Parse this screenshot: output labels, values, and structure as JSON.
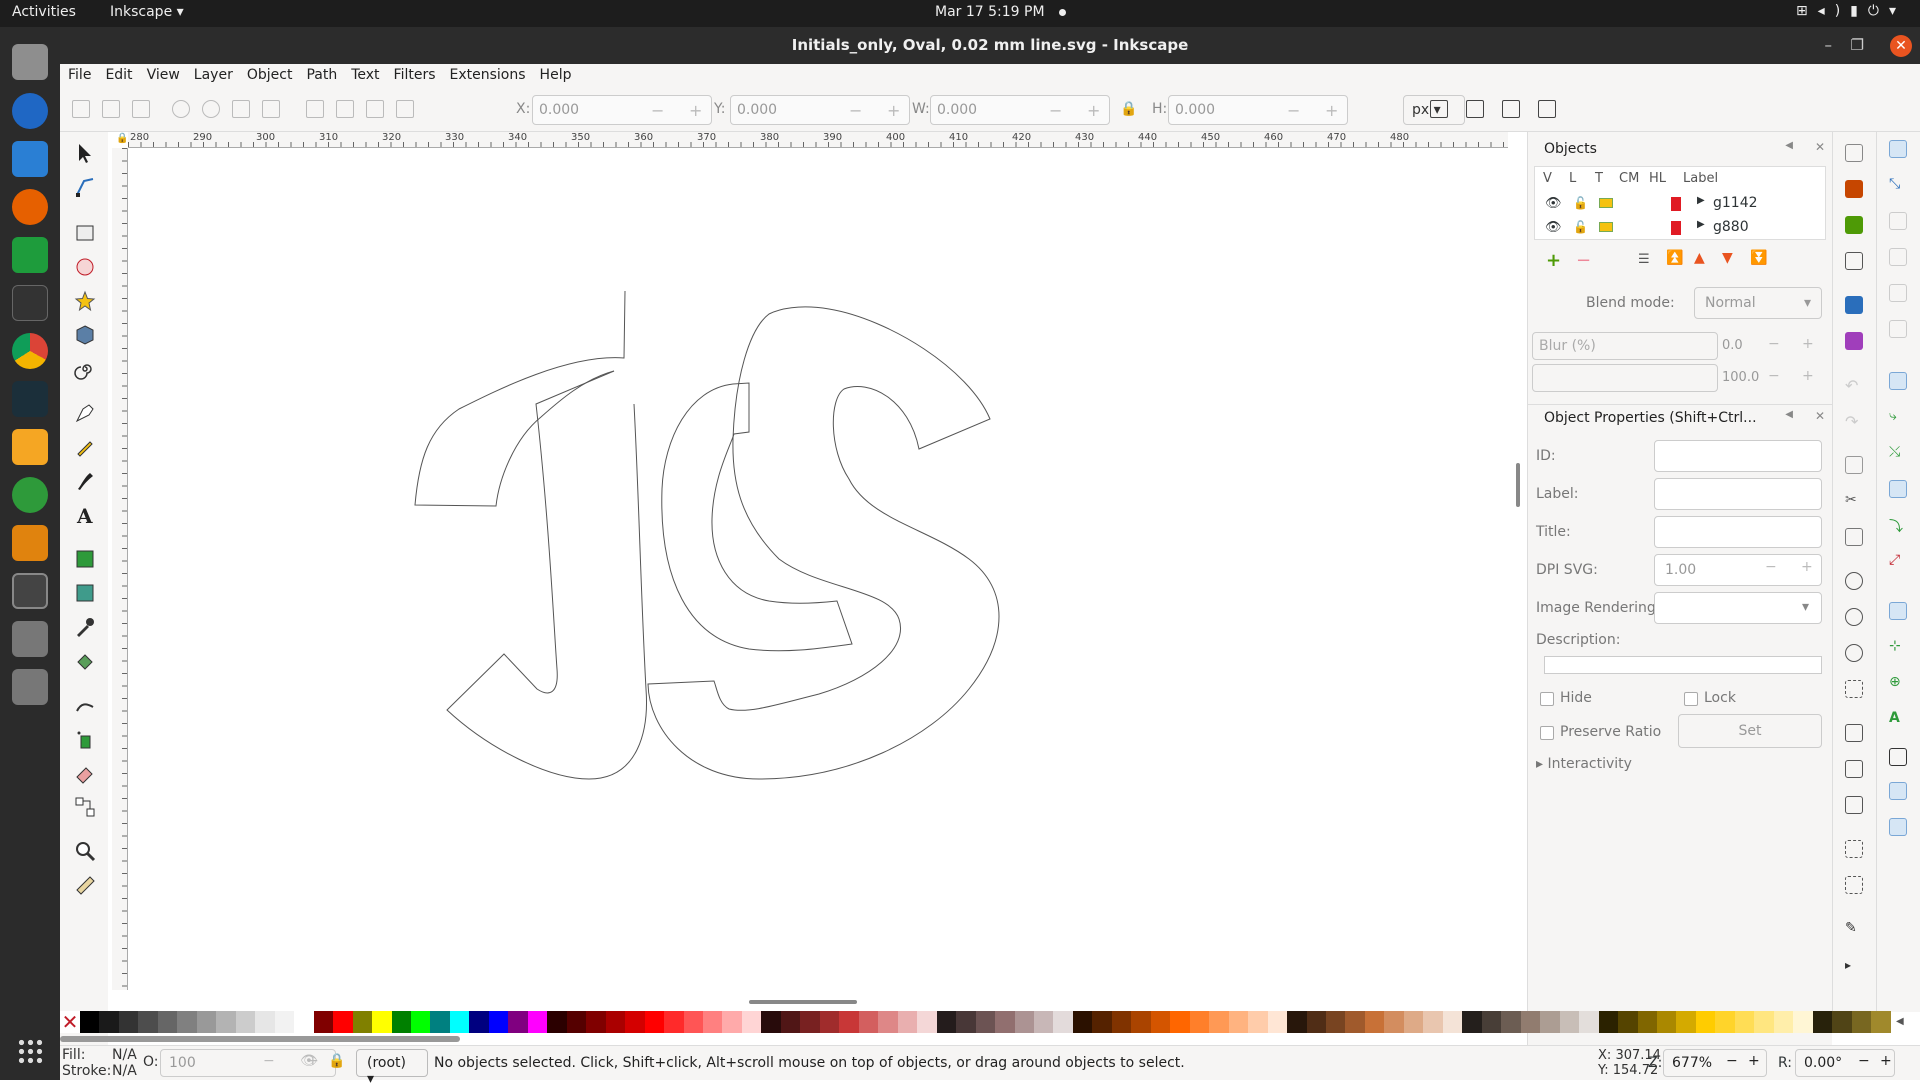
{
  "topbar": {
    "activities": "Activities",
    "app_menu": "Inkscape ▾",
    "clock": "Mar 17  5:19 PM",
    "tray_icons": [
      "network-icon",
      "volume-icon",
      "battery-icon",
      "power-icon"
    ]
  },
  "dock": {
    "apps": [
      "files",
      "thunderbird",
      "writer",
      "firefox",
      "calc",
      "terminal",
      "chrome",
      "system-monitor",
      "calculator",
      "synaptic",
      "impress",
      "inkscape",
      "usb-drive",
      "usb-drive"
    ]
  },
  "window": {
    "title": "Initials_only, Oval, 0.02 mm line.svg - Inkscape"
  },
  "menu": [
    "File",
    "Edit",
    "View",
    "Layer",
    "Object",
    "Path",
    "Text",
    "Filters",
    "Extensions",
    "Help"
  ],
  "commandbar": {
    "x_label": "X:",
    "x_value": "0.000",
    "y_label": "Y:",
    "y_value": "0.000",
    "w_label": "W:",
    "w_value": "0.000",
    "h_label": "H:",
    "h_value": "0.000",
    "unit": "px"
  },
  "rulers": {
    "h_ticks": [
      "280",
      "290",
      "300",
      "310",
      "320",
      "330",
      "340",
      "350",
      "360",
      "370",
      "380",
      "390",
      "400",
      "410",
      "420",
      "430",
      "440",
      "450",
      "460",
      "470",
      "480"
    ]
  },
  "objects_panel": {
    "title": "Objects",
    "columns": [
      "V",
      "L",
      "T",
      "CM",
      "HL",
      "Label"
    ],
    "rows": [
      {
        "label": "g1142"
      },
      {
        "label": "g880"
      }
    ],
    "blend_label": "Blend mode:",
    "blend_value": "Normal",
    "blur_label": "Blur (%)",
    "blur_value": "0.0",
    "opacity_value": "100.0"
  },
  "props_panel": {
    "title": "Object Properties (Shift+Ctrl...",
    "id_label": "ID:",
    "label_label": "Label:",
    "title_label": "Title:",
    "dpi_label": "DPI SVG:",
    "dpi_value": "1.00",
    "render_label": "Image Rendering:",
    "desc_label": "Description:",
    "hide_label": "Hide",
    "lock_label": "Lock",
    "ratio_label": "Preserve Ratio",
    "set_label": "Set",
    "interactivity_label": "Interactivity"
  },
  "palette_colors": [
    "#000000",
    "#1a1a1a",
    "#333333",
    "#4d4d4d",
    "#666666",
    "#808080",
    "#999999",
    "#b3b3b3",
    "#cccccc",
    "#e6e6e6",
    "#f2f2f2",
    "#ffffff",
    "#800000",
    "#ff0000",
    "#808000",
    "#ffff00",
    "#008000",
    "#00ff00",
    "#008080",
    "#00ffff",
    "#000080",
    "#0000ff",
    "#800080",
    "#ff00ff",
    "#2b0000",
    "#550000",
    "#800000",
    "#aa0000",
    "#d40000",
    "#ff0000",
    "#ff2a2a",
    "#ff5555",
    "#ff8080",
    "#ffaaaa",
    "#ffd5d5",
    "#280b0b",
    "#501616",
    "#782121",
    "#a02c2c",
    "#c83737",
    "#d35f5f",
    "#de8787",
    "#e9afaf",
    "#f4d7d7",
    "#241c1c",
    "#483737",
    "#6c5353",
    "#916f6f",
    "#ac9393",
    "#c8b7b7",
    "#e3dbdb",
    "#2b1100",
    "#552200",
    "#803300",
    "#aa4400",
    "#d45500",
    "#ff6600",
    "#ff7f2a",
    "#ff9955",
    "#ffb380",
    "#ffccaa",
    "#ffe6d5",
    "#28170b",
    "#502d16",
    "#784421",
    "#a05a2c",
    "#c87137",
    "#d38d5f",
    "#deaa87",
    "#e9c6af",
    "#f4e3d7",
    "#241f1c",
    "#483e37",
    "#6c5d53",
    "#917c6f",
    "#ac9d93",
    "#c8beb7",
    "#e3dedb",
    "#2b2200",
    "#554400",
    "#806600",
    "#aa8800",
    "#d4aa00",
    "#ffcc00",
    "#ffd42a",
    "#ffdd55",
    "#ffe680",
    "#ffeeaa",
    "#fff6d5",
    "#28220b",
    "#504416",
    "#786721",
    "#a0892c"
  ],
  "statusbar": {
    "fill_label": "Fill:",
    "fill_value": "N/A",
    "stroke_label": "Stroke:",
    "stroke_value": "N/A",
    "opacity_label": "O:",
    "opacity_value": "100",
    "layer": "(root) ▾",
    "message": "No objects selected. Click, Shift+click, Alt+scroll mouse on top of objects, or drag around objects to select.",
    "x_label": "X:",
    "x_value": "307.14",
    "y_label": "Y:",
    "y_value": "154.72",
    "zoom_label": "Z:",
    "zoom_value": "677%",
    "rot_label": "R:",
    "rot_value": "0.00°"
  }
}
